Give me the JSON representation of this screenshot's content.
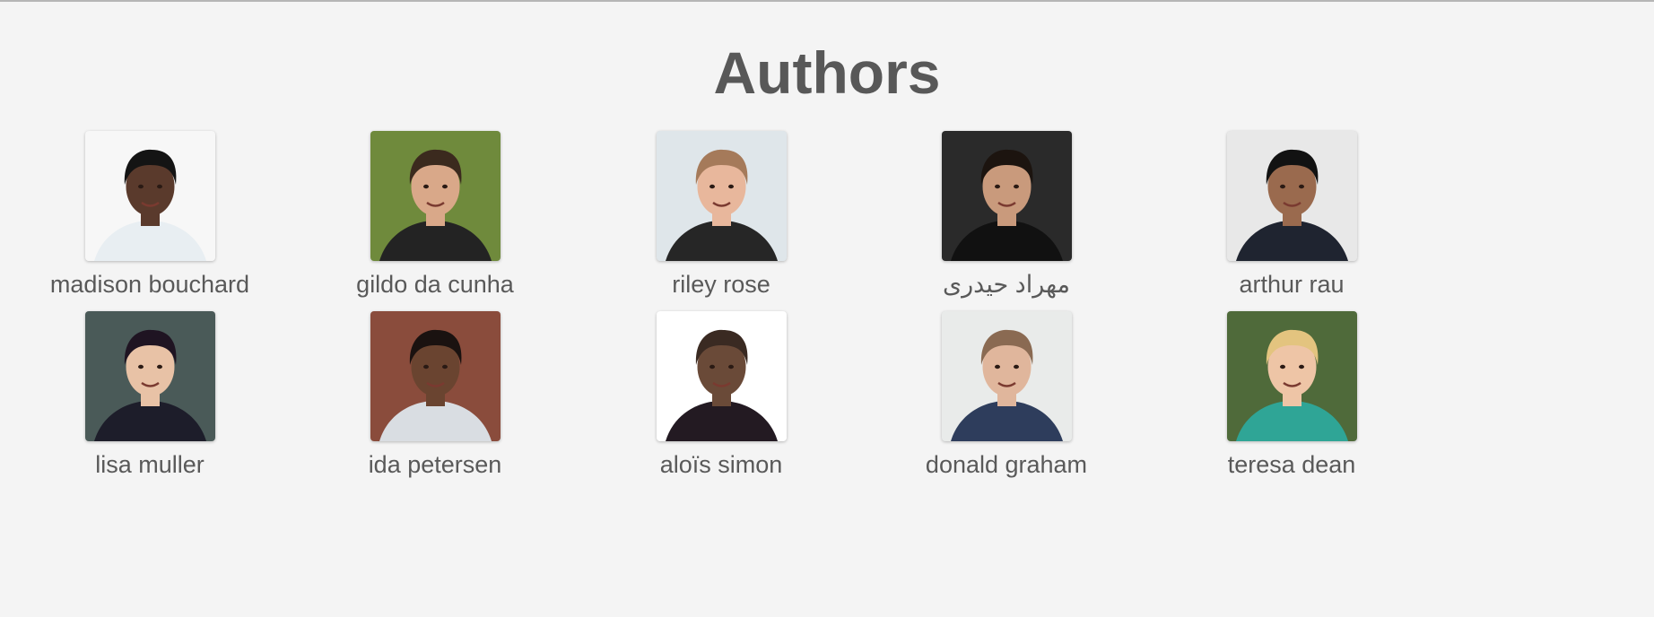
{
  "page": {
    "title": "Authors"
  },
  "authors": [
    {
      "name": "madison bouchard",
      "avatar": "portrait-avatar",
      "bg": "#f7f7f7",
      "skin": "#5a3a2c",
      "hair": "#141414",
      "shirt": "#e8eef2"
    },
    {
      "name": "gildo da cunha",
      "avatar": "portrait-avatar",
      "bg": "#6f8a3c",
      "skin": "#d9a889",
      "hair": "#3b2a1e",
      "shirt": "#232323"
    },
    {
      "name": "riley rose",
      "avatar": "portrait-avatar",
      "bg": "#dfe6ea",
      "skin": "#e8b79c",
      "hair": "#a57a5a",
      "shirt": "#262626"
    },
    {
      "name": "مهراد حیدری",
      "avatar": "portrait-avatar",
      "bg": "#2a2a2a",
      "skin": "#c99a7c",
      "hair": "#1c140f",
      "shirt": "#111111"
    },
    {
      "name": "arthur rau",
      "avatar": "portrait-avatar",
      "bg": "#e8e8e8",
      "skin": "#9a6a4e",
      "hair": "#121212",
      "shirt": "#1f2430"
    },
    {
      "name": "lisa muller",
      "avatar": "portrait-avatar",
      "bg": "#4a5a58",
      "skin": "#e8c2a6",
      "hair": "#1f1422",
      "shirt": "#1d1d2a"
    },
    {
      "name": "ida petersen",
      "avatar": "portrait-avatar",
      "bg": "#8a4c3c",
      "skin": "#6a4430",
      "hair": "#1a1210",
      "shirt": "#d9dde2"
    },
    {
      "name": "aloïs simon",
      "avatar": "portrait-avatar",
      "bg": "#ffffff",
      "skin": "#6a4a38",
      "hair": "#3a2a22",
      "shirt": "#231a22"
    },
    {
      "name": "donald graham",
      "avatar": "portrait-avatar",
      "bg": "#e9ebea",
      "skin": "#e0b69c",
      "hair": "#8a6a52",
      "shirt": "#2e3d5c"
    },
    {
      "name": "teresa dean",
      "avatar": "portrait-avatar",
      "bg": "#4f6a3a",
      "skin": "#eec5a6",
      "hair": "#e3c47f",
      "shirt": "#2fa596"
    }
  ]
}
